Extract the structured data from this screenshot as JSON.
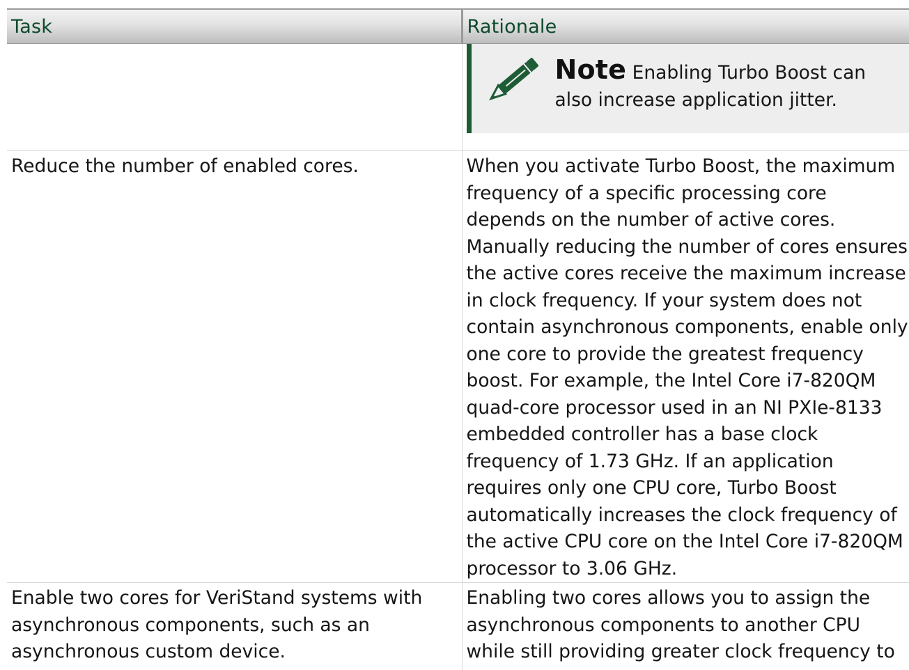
{
  "table": {
    "headers": {
      "task": "Task",
      "rationale": "Rationale"
    },
    "note": {
      "label": "Note",
      "text": "Enabling Turbo Boost can also increase application jitter.",
      "icon": "pencil-icon"
    },
    "rows": [
      {
        "task": "Reduce the number of enabled cores.",
        "rationale": "When you activate Turbo Boost, the maximum frequency of a specific processing core depends on the number of active cores. Manually reducing the number of cores ensures the active cores receive the maximum increase in clock frequency. If your system does not contain asynchronous components, enable only one core to provide the greatest frequency boost. For example, the Intel Core i7-820QM quad-core processor used in an NI PXIe-8133 embedded controller has a base clock frequency of 1.73 GHz. If an application requires only one CPU core, Turbo Boost automatically increases the clock frequency of the active CPU core on the Intel Core i7-820QM processor to 3.06 GHz."
      },
      {
        "task": "Enable two cores for VeriStand systems with asynchronous components, such as an asynchronous custom device.",
        "rationale": "Enabling two cores allows you to assign the asynchronous components to another CPU while still providing greater clock frequency to both active cores."
      }
    ],
    "colors": {
      "header_text": "#0e4a2c",
      "note_border": "#1e5c36",
      "note_bg": "#eeeeee"
    }
  }
}
